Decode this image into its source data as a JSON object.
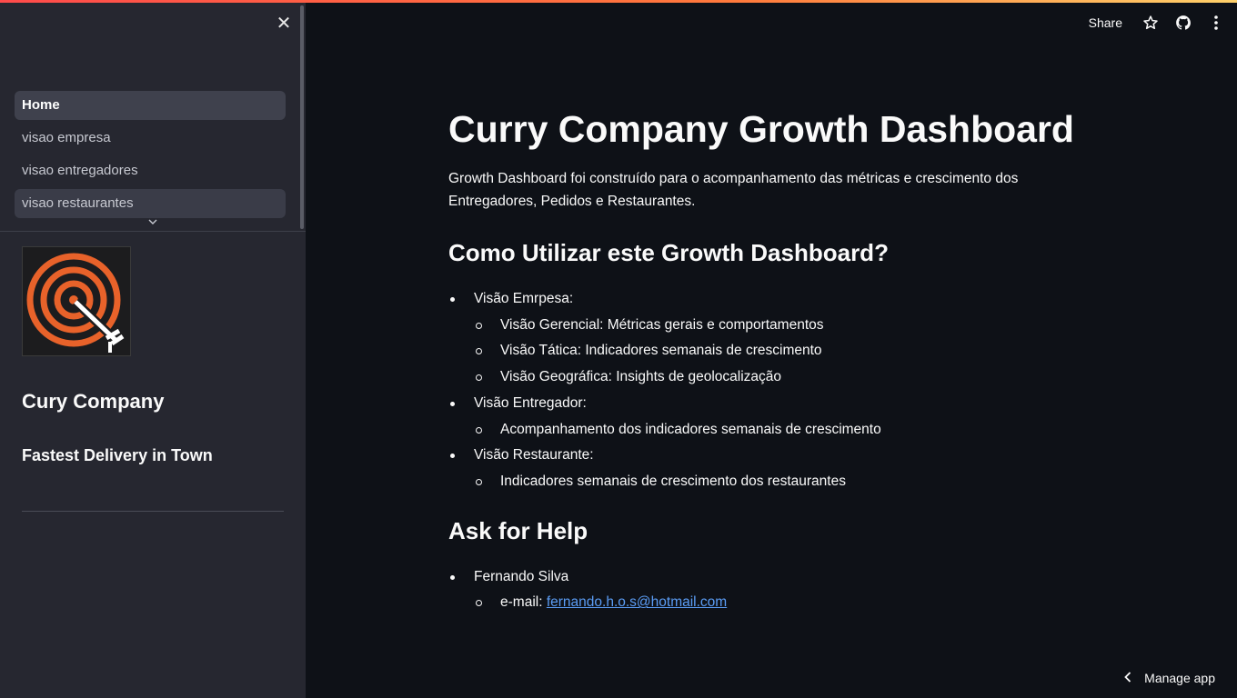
{
  "sidebar": {
    "close_icon": "close-icon",
    "nav": [
      {
        "label": "Home",
        "active": true
      },
      {
        "label": "visao empresa",
        "active": false
      },
      {
        "label": "visao entregadores",
        "active": false
      },
      {
        "label": "visao restaurantes",
        "active": false
      }
    ],
    "brand_title": "Cury Company",
    "brand_subtitle": "Fastest Delivery in Town",
    "logo_icon": "target-logo",
    "logo_colors": {
      "ring": "#e8622a",
      "arrow": "#ffffff",
      "bg": "#1c1c1e"
    }
  },
  "toolbar": {
    "share_label": "Share",
    "icons": [
      "star-icon",
      "github-icon",
      "more-icon"
    ]
  },
  "main": {
    "title": "Curry Company Growth Dashboard",
    "intro": "Growth Dashboard foi construído para o acompanhamento das métricas e crescimento dos Entregadores, Pedidos e Restaurantes.",
    "how_title": "Como Utilizar este Growth Dashboard?",
    "sections": [
      {
        "label": "Visão Emrpesa:",
        "items": [
          "Visão Gerencial: Métricas gerais e comportamentos",
          "Visão Tática: Indicadores semanais de crescimento",
          "Visão Geográfica: Insights de geolocalização"
        ]
      },
      {
        "label": "Visão Entregador:",
        "items": [
          "Acompanhamento dos indicadores semanais de crescimento"
        ]
      },
      {
        "label": "Visão Restaurante:",
        "items": [
          "Indicadores semanais de crescimento dos restaurantes"
        ]
      }
    ],
    "help_title": "Ask for Help",
    "help_name": "Fernando Silva",
    "email_prefix": "e-mail: ",
    "email": "fernando.h.o.s@hotmail.com"
  },
  "footer": {
    "manage_label": "Manage app"
  },
  "colors": {
    "accent_bar_start": "#ff4b4b",
    "accent_bar_end": "#ffd16a",
    "link": "#5b9df5",
    "sidebar_bg": "#262730",
    "main_bg": "#0e1117"
  }
}
